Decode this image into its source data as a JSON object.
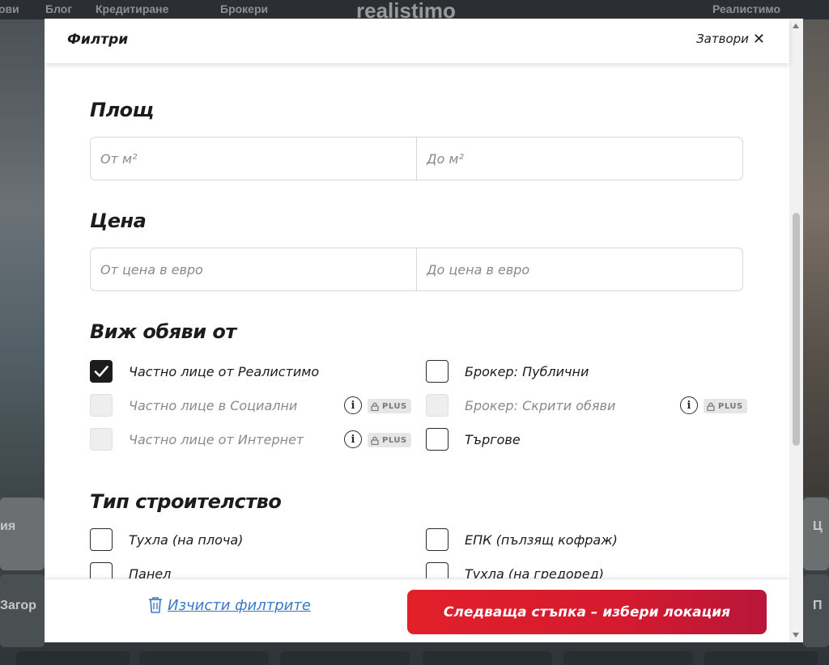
{
  "background": {
    "nav_items": [
      "ови",
      "Блог",
      "Кредитиране",
      "Брокери"
    ],
    "logo": "realistimo",
    "account": "Реалистимо",
    "left_label_1": "ия",
    "left_label_2": "Загор",
    "right_label_1": "Ц",
    "right_label_2": "П"
  },
  "modal": {
    "title": "Филтри",
    "close_label": "Затвори"
  },
  "area": {
    "title": "Площ",
    "from_placeholder": "От м²",
    "to_placeholder": "До м²"
  },
  "price": {
    "title": "Цена",
    "from_placeholder": "От цена в евро",
    "to_placeholder": "До цена в евро"
  },
  "listings_from": {
    "title": "Виж обяви от",
    "options": [
      {
        "label": "Частно лице от Реалистимо",
        "checked": true,
        "disabled": false
      },
      {
        "label": "Частно лице в Социални",
        "checked": false,
        "disabled": true,
        "badge": "PLUS"
      },
      {
        "label": "Частно лице от Интернет",
        "checked": false,
        "disabled": true,
        "badge": "PLUS"
      },
      {
        "label": "Брокер: Публични",
        "checked": false,
        "disabled": false
      },
      {
        "label": "Брокер: Скрити обяви",
        "checked": false,
        "disabled": true,
        "badge": "PLUS"
      },
      {
        "label": "Търгове",
        "checked": false,
        "disabled": false
      }
    ],
    "badge_label": "PLUS"
  },
  "construction": {
    "title": "Тип строителство",
    "options": [
      {
        "label": "Тухла (на плоча)",
        "checked": false
      },
      {
        "label": "Панел",
        "checked": false
      },
      {
        "label": "ЕПК (пълзящ кофраж)",
        "checked": false
      },
      {
        "label": "Тухла (на гредоред)",
        "checked": false
      }
    ]
  },
  "footer": {
    "clear_label": "Изчисти филтрите",
    "next_label": "Следваща стъпка – избери локация"
  },
  "colors": {
    "accent": "#e2202a",
    "link": "#3a78c9",
    "text": "#1c1c1c"
  }
}
